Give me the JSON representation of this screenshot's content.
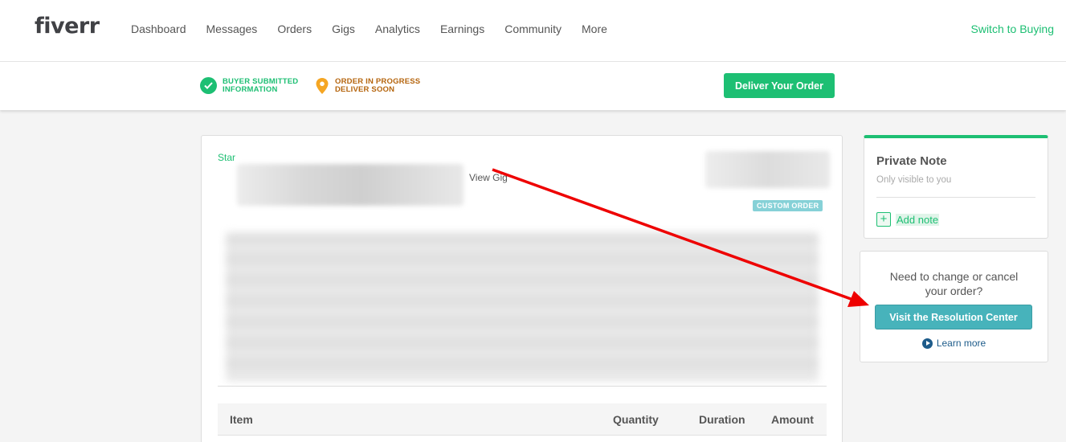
{
  "header": {
    "logo": "fiverr",
    "nav": [
      "Dashboard",
      "Messages",
      "Orders",
      "Gigs",
      "Analytics",
      "Earnings",
      "Community",
      "More"
    ],
    "switch_label": "Switch to Buying"
  },
  "status": {
    "step1_line1": "BUYER SUBMITTED",
    "step1_line2": "INFORMATION",
    "step2_line1": "ORDER IN PROGRESS",
    "step2_line2": "DELIVER SOON",
    "deliver_label": "Deliver Your Order"
  },
  "order": {
    "star_label": "Star",
    "view_gig_label": "View Gig",
    "badge": "CUSTOM ORDER",
    "table_headers": [
      "Item",
      "Quantity",
      "Duration",
      "Amount"
    ]
  },
  "private_note": {
    "title": "Private Note",
    "subtitle": "Only visible to you",
    "add_label": "Add note"
  },
  "resolution": {
    "line1": "Need to change or cancel",
    "line2": "your order?",
    "button_label": "Visit the Resolution Center",
    "learn_more": "Learn more"
  },
  "colors": {
    "brand_green": "#1dbf73",
    "teal_button": "#47b3bb",
    "annotation_red": "#ee0000"
  }
}
